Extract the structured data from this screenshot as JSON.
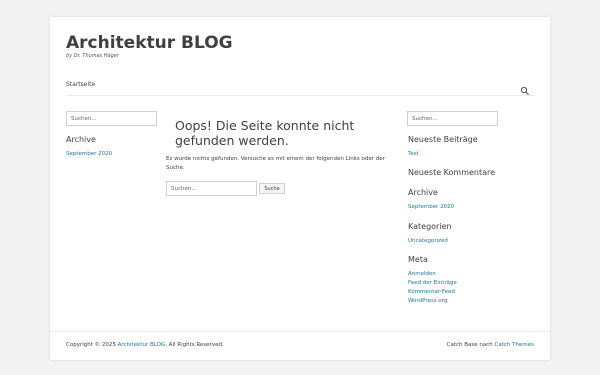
{
  "header": {
    "site_title": "Architektur BLOG",
    "site_description": "by Dr. Thomas Häger"
  },
  "nav": {
    "home_label": "Startseite",
    "search_icon": "search-icon"
  },
  "left_sidebar": {
    "search_placeholder": "Suchen...",
    "archive_title": "Archive",
    "archive_items": [
      "September 2020"
    ]
  },
  "main": {
    "title": "Oops! Die Seite konnte nicht gefunden werden.",
    "message": "Es wurde nichts gefunden. Versuche es mit einem der folgenden Links oder der Suche.",
    "search_placeholder": "Suchen...",
    "search_button": "Suche"
  },
  "right_sidebar": {
    "search_placeholder": "Suchen...",
    "recent_posts_title": "Neueste Beiträge",
    "recent_posts": [
      "Test"
    ],
    "recent_comments_title": "Neueste Kommentare",
    "archive_title": "Archive",
    "archive_items": [
      "September 2020"
    ],
    "categories_title": "Kategorien",
    "categories": [
      "Uncategorized"
    ],
    "meta_title": "Meta",
    "meta_links": [
      "Anmelden",
      "Feed der Einträge",
      "Kommentar-Feed",
      "WordPress.org"
    ]
  },
  "footer": {
    "copyright_prefix": "Copyright © 2025",
    "copyright_link": "Architektur BLOG",
    "copyright_suffix": ". All Rights Reserved.",
    "credit_prefix": "Catch Base nach",
    "credit_link": "Catch Themes"
  },
  "colors": {
    "link": "#21759b",
    "text": "#404040",
    "background": "#f2f2f2"
  }
}
